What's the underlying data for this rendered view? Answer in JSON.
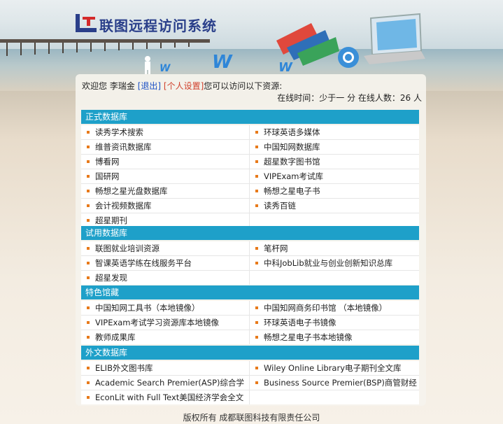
{
  "header": {
    "title": "联图远程访问系统"
  },
  "user": {
    "welcome_prefix": "欢迎您",
    "name": "李瑞金",
    "logout_label": "[退出]",
    "settings_label": "[个人设置]",
    "suffix": "您可以访问以下资源:"
  },
  "status": {
    "text": "在线时间：少于一 分 在线人数：26 人"
  },
  "sections": [
    {
      "title": "正式数据库",
      "items": [
        "读秀学术搜索",
        "环球英语多媒体",
        "维普资讯数据库",
        "中国知网数据库",
        "博看网",
        "超星数字图书馆",
        "国研网",
        "VIPExam考试库",
        "畅想之星光盘数据库",
        "畅想之星电子书",
        "会计视频数据库",
        "读秀百链",
        "超星期刊",
        ""
      ]
    },
    {
      "title": "试用数据库",
      "items": [
        "联图就业培训资源",
        "笔杆网",
        "智课英语学练在线服务平台",
        "中科JobLib就业与创业创新知识总库",
        "超星发现",
        ""
      ]
    },
    {
      "title": "特色馆藏",
      "items": [
        "中国知网工具书（本地镜像）",
        "中国知网商务印书馆 （本地镜像）",
        "VIPExam考试学习资源库本地镜像",
        "环球英语电子书镜像",
        "教师成果库",
        "畅想之星电子书本地镜像"
      ]
    },
    {
      "title": "外文数据库",
      "items": [
        "ELIB外文图书库",
        "Wiley Online Library电子期刊全文库",
        "Academic Search Premier(ASP)综合学",
        "Business Source Premier(BSP)商管财经",
        "EconLit with Full Text美国经济学会全文",
        ""
      ]
    }
  ],
  "footer": {
    "text": "版权所有 成都联图科技有限责任公司"
  }
}
